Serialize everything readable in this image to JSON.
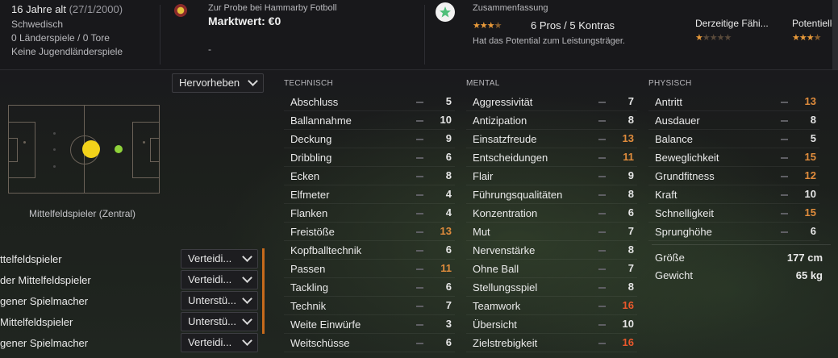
{
  "header": {
    "age": "16 Jahre alt",
    "birthdate": "(27/1/2000)",
    "nationality": "Schwedisch",
    "caps": "0 Länderspiele / 0 Tore",
    "youth_caps": "Keine Jugendländerspiele",
    "trial_text": "Zur Probe bei Hammarby Fotboll",
    "market_value": "Marktwert: €0",
    "dash": "-",
    "summary_title": "Zusammenfassung",
    "pros_cons": "6 Pros / 5 Kontras",
    "summary_text": "Hat das Potential zum Leistungsträger.",
    "current_ability_label": "Derzeitige Fähi...",
    "potential_label": "Potentielle",
    "summary_rating": 3.5,
    "current_ability_stars": 1,
    "potential_stars": 3.5
  },
  "highlight_dropdown": "Hervorheben",
  "position_label": "Mittelfeldspieler (Zentral)",
  "columns": {
    "technical": "TECHNISCH",
    "mental": "MENTAL",
    "physical": "PHYSISCH"
  },
  "technical": [
    {
      "name": "Abschluss",
      "value": "5"
    },
    {
      "name": "Ballannahme",
      "value": "10"
    },
    {
      "name": "Deckung",
      "value": "9"
    },
    {
      "name": "Dribbling",
      "value": "6"
    },
    {
      "name": "Ecken",
      "value": "8"
    },
    {
      "name": "Elfmeter",
      "value": "4"
    },
    {
      "name": "Flanken",
      "value": "4"
    },
    {
      "name": "Freistöße",
      "value": "13"
    },
    {
      "name": "Kopfballtechnik",
      "value": "6"
    },
    {
      "name": "Passen",
      "value": "11"
    },
    {
      "name": "Tackling",
      "value": "6"
    },
    {
      "name": "Technik",
      "value": "7"
    },
    {
      "name": "Weite Einwürfe",
      "value": "3"
    },
    {
      "name": "Weitschüsse",
      "value": "6"
    }
  ],
  "mental": [
    {
      "name": "Aggressivität",
      "value": "7"
    },
    {
      "name": "Antizipation",
      "value": "8"
    },
    {
      "name": "Einsatzfreude",
      "value": "13"
    },
    {
      "name": "Entscheidungen",
      "value": "11"
    },
    {
      "name": "Flair",
      "value": "9"
    },
    {
      "name": "Führungsqualitäten",
      "value": "8"
    },
    {
      "name": "Konzentration",
      "value": "6"
    },
    {
      "name": "Mut",
      "value": "7"
    },
    {
      "name": "Nervenstärke",
      "value": "8"
    },
    {
      "name": "Ohne Ball",
      "value": "7"
    },
    {
      "name": "Stellungsspiel",
      "value": "8"
    },
    {
      "name": "Teamwork",
      "value": "16"
    },
    {
      "name": "Übersicht",
      "value": "10"
    },
    {
      "name": "Zielstrebigkeit",
      "value": "16"
    }
  ],
  "physical": [
    {
      "name": "Antritt",
      "value": "13"
    },
    {
      "name": "Ausdauer",
      "value": "8"
    },
    {
      "name": "Balance",
      "value": "5"
    },
    {
      "name": "Beweglichkeit",
      "value": "15"
    },
    {
      "name": "Grundfitness",
      "value": "12"
    },
    {
      "name": "Kraft",
      "value": "10"
    },
    {
      "name": "Schnelligkeit",
      "value": "15"
    },
    {
      "name": "Sprunghöhe",
      "value": "6"
    }
  ],
  "body": {
    "height_label": "Größe",
    "height_value": "177 cm",
    "weight_label": "Gewicht",
    "weight_value": "65 kg"
  },
  "roles": [
    {
      "name": "ttelfeldspieler",
      "duty": "Verteidi..."
    },
    {
      "name": "der Mittelfeldspieler",
      "duty": "Verteidi..."
    },
    {
      "name": "gener Spielmacher",
      "duty": "Unterstü..."
    },
    {
      "name": "Mittelfeldspieler",
      "duty": "Unterstü..."
    },
    {
      "name": "gener Spielmacher",
      "duty": "Verteidi..."
    }
  ],
  "colors": {
    "accent_orange": "#e08c3c",
    "accent_red": "#e9582c",
    "star": "#e99a3a",
    "player_dot": "#f2d21a",
    "secondary_dot": "#8fd23a",
    "summary_icon": "#4fbf7a"
  }
}
